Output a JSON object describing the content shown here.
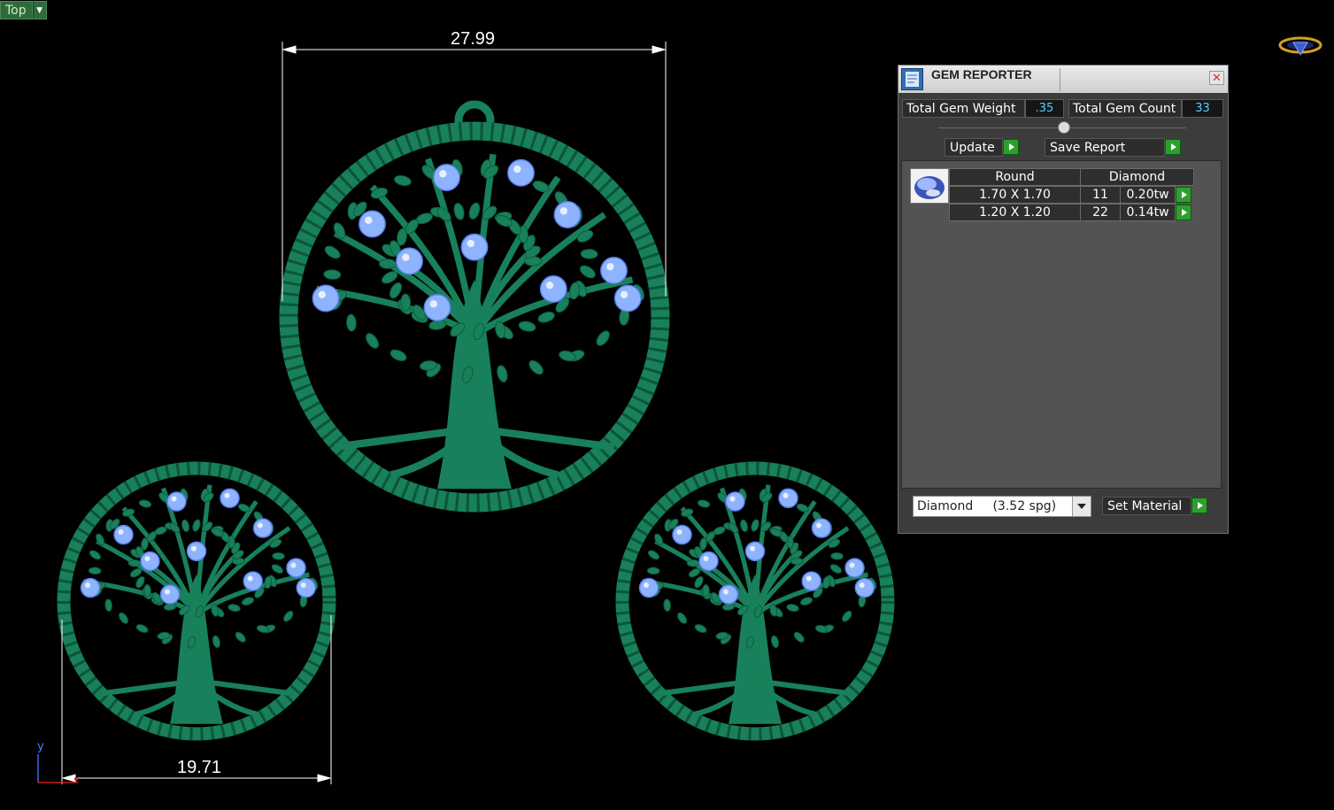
{
  "viewport": {
    "view_name": "Top",
    "dimension_top": "27.99",
    "dimension_bottom": "19.71",
    "axis_label": "y",
    "logo_icon": "gem-logo-icon",
    "model_color": "#18805a",
    "gem_color": "#8fb4ff"
  },
  "gem_reporter": {
    "title": "GEM REPORTER",
    "total_weight_label": "Total Gem Weight",
    "total_weight_value": ".35",
    "total_count_label": "Total Gem Count",
    "total_count_value": "33",
    "update_label": "Update",
    "save_report_label": "Save Report",
    "table": {
      "headers": [
        "Round",
        "Diamond"
      ],
      "rows": [
        {
          "size": "1.70 X 1.70",
          "count": "11",
          "weight": "0.20tw"
        },
        {
          "size": "1.20 X 1.20",
          "count": "22",
          "weight": "0.14tw"
        }
      ]
    },
    "material_selected": "Diamond     (3.52 spg)",
    "set_material_label": "Set Material",
    "accent_color": "#2e9e2e",
    "value_color": "#4fd0ff"
  }
}
